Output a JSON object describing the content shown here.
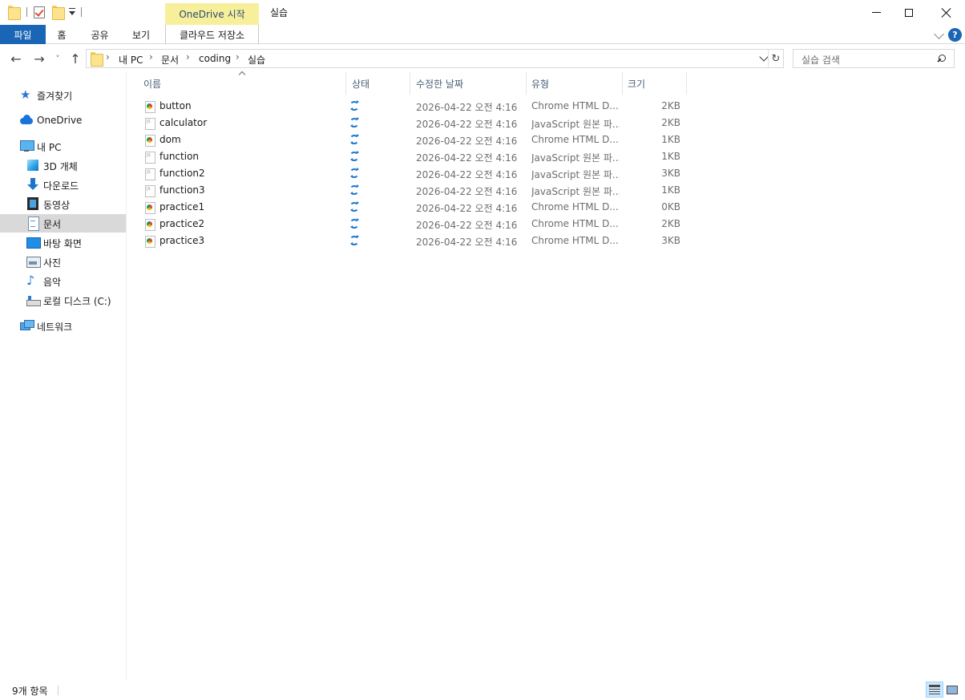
{
  "window": {
    "title": "실습",
    "context_group": "OneDrive 시작",
    "minimize_icon": "minimize-icon",
    "maximize_icon": "maximize-icon",
    "close_icon": "close-icon"
  },
  "ribbon": {
    "tabs": [
      {
        "label": "파일",
        "active": true
      },
      {
        "label": "홈"
      },
      {
        "label": "공유"
      },
      {
        "label": "보기"
      },
      {
        "label": "클라우드 저장소"
      }
    ],
    "help_label": "?"
  },
  "nav": {
    "back_label": "←",
    "forward_label": "→",
    "recent_label": "˅",
    "up_label": "↑",
    "refresh_label": "↻"
  },
  "address": {
    "crumbs": [
      "내 PC",
      "문서",
      "coding",
      "실습"
    ],
    "sep": "›"
  },
  "search": {
    "placeholder": "실습 검색"
  },
  "sidebar": {
    "items": [
      {
        "label": "즐겨찾기",
        "icon": "star-icon"
      },
      {
        "label": "OneDrive",
        "icon": "onedrive-icon"
      },
      {
        "label": "내 PC",
        "icon": "pc-icon"
      },
      {
        "label": "3D 개체",
        "icon": "cube-icon"
      },
      {
        "label": "다운로드",
        "icon": "download-icon"
      },
      {
        "label": "동영상",
        "icon": "video-icon"
      },
      {
        "label": "문서",
        "icon": "document-icon",
        "active": true
      },
      {
        "label": "바탕 화면",
        "icon": "desktop-icon"
      },
      {
        "label": "사진",
        "icon": "picture-icon"
      },
      {
        "label": "음악",
        "icon": "music-icon"
      },
      {
        "label": "로컬 디스크 (C:)",
        "icon": "drive-icon"
      },
      {
        "label": "네트워크",
        "icon": "network-icon"
      }
    ]
  },
  "columns": {
    "name": "이름",
    "status": "상태",
    "modified": "수정한 날짜",
    "type": "유형",
    "size": "크기"
  },
  "files": [
    {
      "name": "button",
      "kind": "chrome",
      "date": "2026-04-22 오전 4:16",
      "type": "Chrome HTML D...",
      "size": "2KB"
    },
    {
      "name": "calculator",
      "kind": "js",
      "date": "2026-04-22 오전 4:16",
      "type": "JavaScript 원본 파...",
      "size": "2KB"
    },
    {
      "name": "dom",
      "kind": "chrome",
      "date": "2026-04-22 오전 4:16",
      "type": "Chrome HTML D...",
      "size": "1KB"
    },
    {
      "name": "function",
      "kind": "js",
      "date": "2026-04-22 오전 4:16",
      "type": "JavaScript 원본 파...",
      "size": "1KB"
    },
    {
      "name": "function2",
      "kind": "js",
      "date": "2026-04-22 오전 4:16",
      "type": "JavaScript 원본 파...",
      "size": "3KB"
    },
    {
      "name": "function3",
      "kind": "js",
      "date": "2026-04-22 오전 4:16",
      "type": "JavaScript 원본 파...",
      "size": "1KB"
    },
    {
      "name": "practice1",
      "kind": "chrome",
      "date": "2026-04-22 오전 4:16",
      "type": "Chrome HTML D...",
      "size": "0KB"
    },
    {
      "name": "practice2",
      "kind": "chrome",
      "date": "2026-04-22 오전 4:16",
      "type": "Chrome HTML D...",
      "size": "2KB"
    },
    {
      "name": "practice3",
      "kind": "chrome",
      "date": "2026-04-22 오전 4:16",
      "type": "Chrome HTML D...",
      "size": "3KB"
    }
  ],
  "status": {
    "item_count": "9개 항목"
  },
  "colors": {
    "accent": "#1a65b5",
    "context_tab": "#f7ef9a",
    "selection": "#d9d9d9"
  }
}
